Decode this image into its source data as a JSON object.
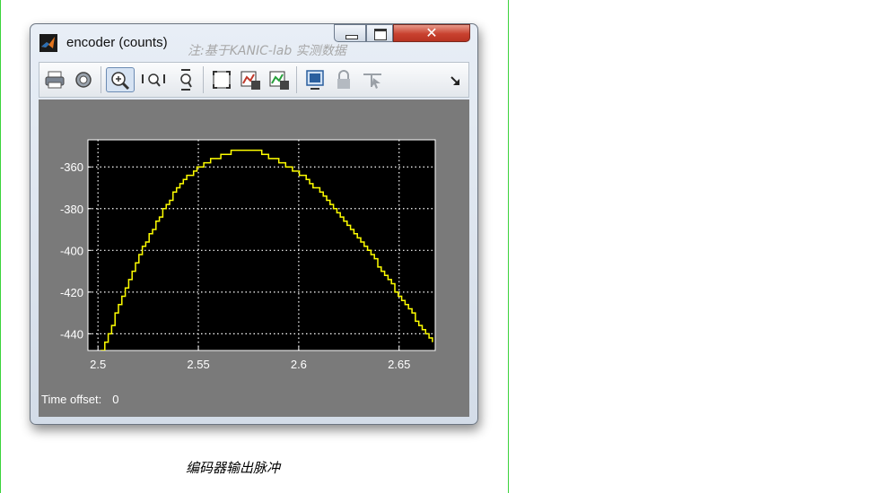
{
  "window": {
    "title": "encoder (counts)",
    "watermark": "注:基于KANIC-lab 实测数据",
    "close_glyph": "✕"
  },
  "toolbar": {
    "items": [
      {
        "name": "print-icon"
      },
      {
        "name": "parameters-icon"
      },
      {
        "name": "zoom-in-icon",
        "active": true
      },
      {
        "name": "zoom-x-icon"
      },
      {
        "name": "zoom-y-icon"
      },
      {
        "name": "autoscale-icon"
      },
      {
        "name": "save-axes-icon"
      },
      {
        "name": "restore-axes-icon"
      },
      {
        "name": "floating-scope-icon"
      },
      {
        "name": "lock-axes-icon"
      },
      {
        "name": "signal-selector-icon"
      },
      {
        "name": "dock-arrow-icon"
      }
    ]
  },
  "time_offset": {
    "label": "Time offset:",
    "value": "0"
  },
  "caption": "编码器输出脉冲",
  "colors": {
    "plot_bg": "#000000",
    "panel_bg": "#7a7a7a",
    "trace": "#ffff00",
    "grid": "#ffffff",
    "tick_text": "#ffffff"
  },
  "chart_data": {
    "type": "line",
    "title": "encoder (counts)",
    "xlabel": "",
    "ylabel": "",
    "xlim": [
      2.495,
      2.668
    ],
    "ylim": [
      -448,
      -347
    ],
    "xticks": [
      2.5,
      2.55,
      2.6,
      2.65
    ],
    "xtick_labels": [
      "2.5",
      "2.55",
      "2.6",
      "2.65"
    ],
    "yticks": [
      -360,
      -380,
      -400,
      -420,
      -440
    ],
    "ytick_labels": [
      "-360",
      "-380",
      "-400",
      "-420",
      "-440"
    ],
    "grid": true,
    "step": true,
    "series": [
      {
        "x": [
          2.5,
          2.505,
          2.51,
          2.515,
          2.52,
          2.525,
          2.53,
          2.535,
          2.54,
          2.545,
          2.55,
          2.555,
          2.56,
          2.565,
          2.57,
          2.575,
          2.58,
          2.585,
          2.59,
          2.595,
          2.6,
          2.605,
          2.61,
          2.615,
          2.62,
          2.625,
          2.63,
          2.635,
          2.64,
          2.645,
          2.65,
          2.655,
          2.66,
          2.665,
          2.668
        ],
        "y": [
          -452,
          -440,
          -427,
          -415,
          -403,
          -393,
          -384,
          -376,
          -369,
          -364,
          -360,
          -357,
          -355,
          -353,
          -352,
          -352,
          -353,
          -355,
          -357,
          -360,
          -363,
          -367,
          -372,
          -377,
          -383,
          -389,
          -395,
          -401,
          -408,
          -415,
          -422,
          -429,
          -436,
          -443,
          -446
        ]
      }
    ]
  }
}
